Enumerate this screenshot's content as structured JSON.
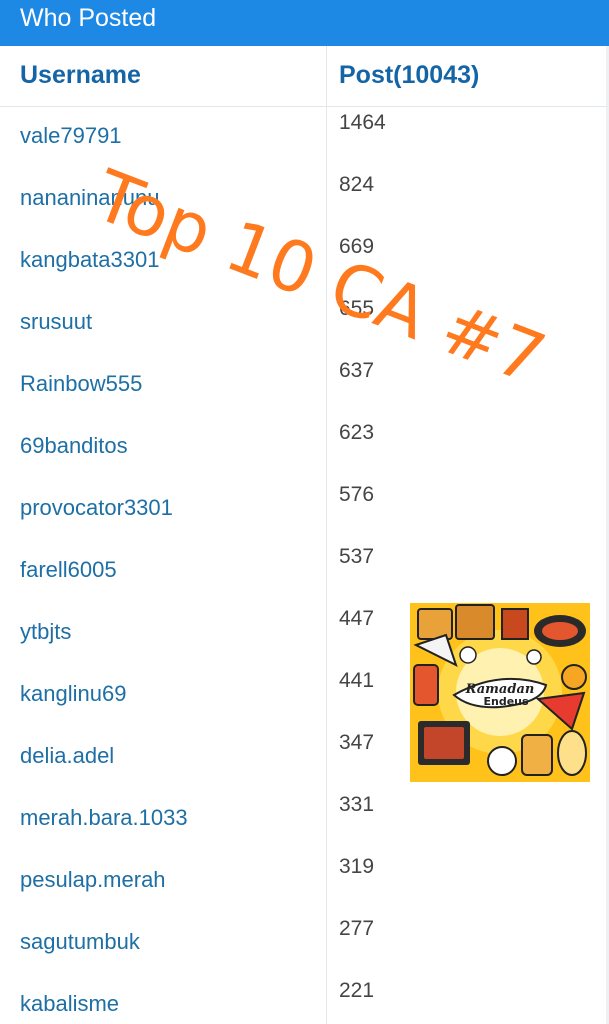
{
  "header": {
    "title": "Who Posted"
  },
  "table": {
    "col_username": "Username",
    "col_post": "Post(10043)",
    "rows": [
      {
        "username": "vale79791",
        "posts": "1464"
      },
      {
        "username": "nananinanunu",
        "posts": "824"
      },
      {
        "username": "kangbata3301",
        "posts": "669"
      },
      {
        "username": "srusuut",
        "posts": "655"
      },
      {
        "username": "Rainbow555",
        "posts": "637"
      },
      {
        "username": "69banditos",
        "posts": "623"
      },
      {
        "username": "provocator3301",
        "posts": "576"
      },
      {
        "username": "farell6005",
        "posts": "537"
      },
      {
        "username": "ytbjts",
        "posts": "447"
      },
      {
        "username": "kanglinu69",
        "posts": "441"
      },
      {
        "username": "delia.adel",
        "posts": "347"
      },
      {
        "username": "merah.bara.1033",
        "posts": "331"
      },
      {
        "username": "pesulap.merah",
        "posts": "319"
      },
      {
        "username": "sagutumbuk",
        "posts": "277"
      },
      {
        "username": "kabalisme",
        "posts": "221"
      }
    ]
  },
  "overlay": {
    "text": "Top 10 CA #7"
  },
  "promo": {
    "logo_text": "Ramadan Endeus"
  },
  "colors": {
    "header_bg": "#1e88e5",
    "username": "#1d6fa5",
    "overlay": "#ff7a1f"
  }
}
